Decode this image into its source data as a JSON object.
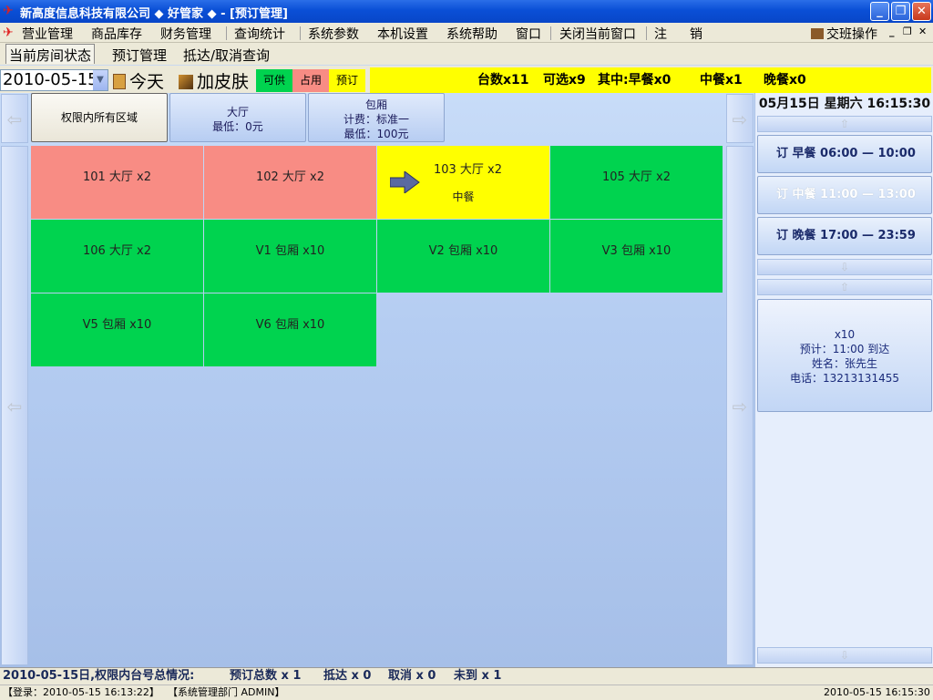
{
  "window": {
    "title": "新高度信息科技有限公司 ◆ 好管家 ◆ - [预订管理]",
    "minimize_label": "_",
    "maximize_label": "❐",
    "close_label": "✕"
  },
  "menu": {
    "items": [
      "营业管理",
      "商品库存",
      "财务管理",
      "查询统计",
      "系统参数",
      "本机设置",
      "系统帮助",
      "窗口",
      "关闭当前窗口",
      "注",
      "销"
    ],
    "shift_label": "交班操作",
    "mdi_min": "_",
    "mdi_restore": "❐",
    "mdi_close": "✕"
  },
  "tabs": [
    "当前房间状态",
    "预订管理",
    "抵达/取消查询"
  ],
  "toolbar": {
    "date": "2010-05-15",
    "today_label": "今天",
    "skin_label": "加皮肤",
    "legend": [
      {
        "label": "可供",
        "color": "#00d34f"
      },
      {
        "label": "占用",
        "color": "#f88c84"
      },
      {
        "label": "预订",
        "color": "#ffff00"
      }
    ],
    "summary": {
      "tables": "台数x11",
      "available": "可选x9",
      "breakfast": "其中:早餐x0",
      "lunch": "中餐x1",
      "dinner": "晚餐x0"
    }
  },
  "areas": [
    {
      "lines": [
        "权限内所有区域"
      ],
      "selected": true
    },
    {
      "lines": [
        "大厅",
        "最低：0元"
      ],
      "selected": false
    },
    {
      "lines": [
        "包厢",
        "计费：标准一",
        "最低：100元"
      ],
      "selected": false
    }
  ],
  "tables": [
    {
      "label": "101 大厅 x2",
      "status": "red"
    },
    {
      "label": "102 大厅 x2",
      "status": "red"
    },
    {
      "label": "103 大厅 x2",
      "status": "yellow",
      "sub": "中餐"
    },
    {
      "label": "105 大厅 x2",
      "status": "green"
    },
    {
      "label": "106 大厅 x2",
      "status": "green"
    },
    {
      "label": "V1 包厢 x10",
      "status": "green"
    },
    {
      "label": "V2 包厢 x10",
      "status": "green"
    },
    {
      "label": "V3 包厢 x10",
      "status": "green"
    },
    {
      "label": "V5 包厢 x10",
      "status": "green"
    },
    {
      "label": "V6 包厢 x10",
      "status": "green"
    }
  ],
  "panel": {
    "datetime": "05月15日 星期六 16:15:30",
    "meals": [
      {
        "label": "订  早餐    06:00 — 10:00",
        "dim": false
      },
      {
        "label": "订  中餐    11:00 — 13:00",
        "dim": true
      },
      {
        "label": "订  晚餐    17:00 — 23:59",
        "dim": false
      }
    ],
    "reservation": {
      "count": "x10",
      "arrival": "预计：11:00  到达",
      "name": "姓名：张先生",
      "phone": "电话：13213131455"
    }
  },
  "status1": {
    "prefix": "2010-05-15日,权限内台号总情况:",
    "total": "预订总数 x 1",
    "arrived": "抵达 x 0",
    "cancelled": "取消 x 0",
    "not_arrived": "未到 x 1"
  },
  "status2": {
    "login": "【登录：2010-05-15 16:13:22】",
    "dept": "【系统管理部门  ADMIN】",
    "clock": "2010-05-15 16:15:30"
  }
}
